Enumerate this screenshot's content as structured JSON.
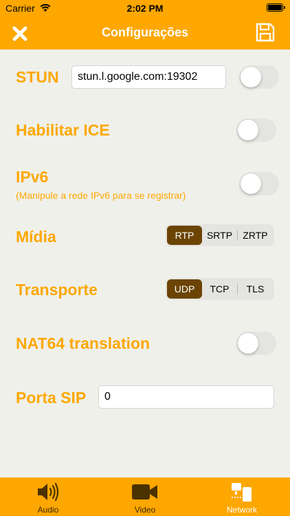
{
  "status_bar": {
    "carrier": "Carrier",
    "time": "2:02 PM"
  },
  "nav": {
    "title": "Configurações",
    "close_icon": "close-icon",
    "save_icon": "floppy-disk-icon"
  },
  "settings": {
    "stun": {
      "label": "STUN",
      "value": "stun.l.google.com:19302",
      "enabled": false
    },
    "ice": {
      "label": "Habilitar ICE",
      "enabled": false
    },
    "ipv6": {
      "label": "IPv6",
      "hint": "(Manipule a rede IPv6 para se registrar)",
      "enabled": false
    },
    "media": {
      "label": "Mídia",
      "options": [
        "RTP",
        "SRTP",
        "ZRTP"
      ],
      "selected": "RTP"
    },
    "transport": {
      "label": "Transporte",
      "options": [
        "UDP",
        "TCP",
        "TLS"
      ],
      "selected": "UDP"
    },
    "nat64": {
      "label": "NAT64 translation",
      "enabled": false
    },
    "sip_port": {
      "label": "Porta SIP",
      "value": "0"
    }
  },
  "tabs": [
    {
      "label": "Audio",
      "icon": "speaker-icon",
      "active": false
    },
    {
      "label": "Video",
      "icon": "video-camera-icon",
      "active": false
    },
    {
      "label": "Network",
      "icon": "network-devices-icon",
      "active": true
    }
  ],
  "colors": {
    "accent": "#fda700",
    "selected_segment": "#6b4404",
    "background": "#f0f0eb"
  }
}
